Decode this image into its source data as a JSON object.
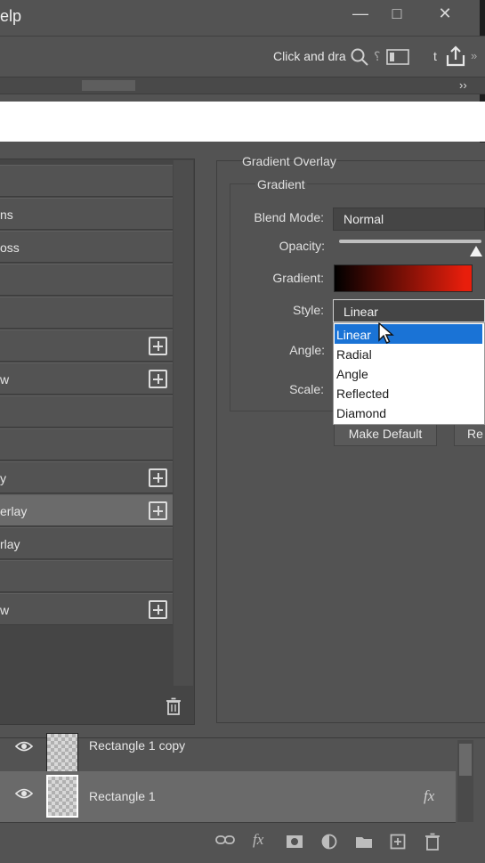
{
  "titlebar": {
    "menu_label": "elp",
    "minimize_glyph": "―",
    "maximize_glyph": "□",
    "close_glyph": "✕"
  },
  "options_bar": {
    "hint": "Click and dra",
    "icons": [
      "search-icon",
      "panel-icon",
      "share-icon"
    ],
    "fragments": [
      "⸮",
      "t",
      "»"
    ],
    "collapse_glyph": "››"
  },
  "styles_list": {
    "items": [
      {
        "label": "",
        "plus": false,
        "active": false
      },
      {
        "label": "ns",
        "plus": false,
        "active": false
      },
      {
        "label": "oss",
        "plus": false,
        "active": false
      },
      {
        "label": "",
        "plus": false,
        "active": false
      },
      {
        "label": "",
        "plus": false,
        "active": false
      },
      {
        "label": "",
        "plus": true,
        "active": false
      },
      {
        "label": "w",
        "plus": true,
        "active": false
      },
      {
        "label": "",
        "plus": false,
        "active": false
      },
      {
        "label": "",
        "plus": false,
        "active": false
      },
      {
        "label": "y",
        "plus": true,
        "active": false
      },
      {
        "label": "erlay",
        "plus": true,
        "active": true
      },
      {
        "label": "rlay",
        "plus": false,
        "active": false
      },
      {
        "label": "",
        "plus": false,
        "active": false
      },
      {
        "label": "w",
        "plus": true,
        "active": false
      }
    ],
    "trash_icon": "trash-icon"
  },
  "gradient_overlay": {
    "section_title": "Gradient Overlay",
    "group_title": "Gradient",
    "blend_mode_label": "Blend Mode:",
    "blend_mode_value": "Normal",
    "opacity_label": "Opacity:",
    "opacity_value": 1.0,
    "gradient_label": "Gradient:",
    "gradient_colors": [
      "#000000",
      "#e81e0c"
    ],
    "style_label": "Style:",
    "style_value": "Linear",
    "style_options": [
      "Linear",
      "Radial",
      "Angle",
      "Reflected",
      "Diamond"
    ],
    "style_selected_index": 0,
    "angle_label": "Angle:",
    "scale_label": "Scale:",
    "make_default_label": "Make Default",
    "reset_label": "Re"
  },
  "layers": {
    "rows": [
      {
        "name": "Rectangle 1 copy",
        "selected": false,
        "fx": ""
      },
      {
        "name": "Rectangle 1",
        "selected": true,
        "fx": "fx"
      }
    ],
    "bottom_icons": [
      "link-icon",
      "fx-icon",
      "mask-icon",
      "adjustment-icon",
      "folder-icon",
      "new-layer-icon",
      "trash-icon"
    ]
  },
  "colors": {
    "panel_bg": "#535353",
    "dropdown_highlight": "#1a73d6"
  }
}
